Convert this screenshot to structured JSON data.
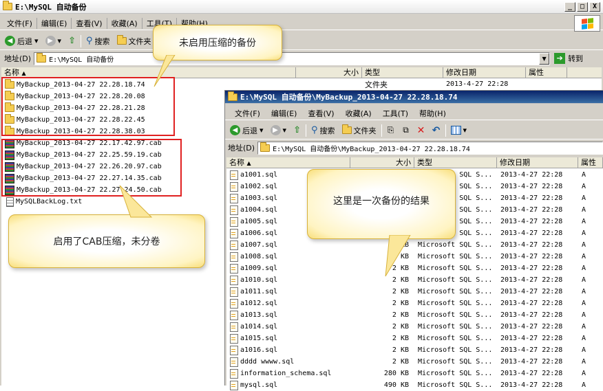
{
  "window1": {
    "title": "E:\\MySQL 自动备份",
    "caption_buttons": [
      "_",
      "□",
      "X"
    ],
    "menu": [
      "文件(F)",
      "编辑(E)",
      "查看(V)",
      "收藏(A)",
      "工具(T)",
      "帮助(H)"
    ],
    "toolbar": {
      "back": "后退",
      "search": "搜索",
      "folders": "文件夹"
    },
    "address_label": "地址(D)",
    "address_value": "E:\\MySQL 自动备份",
    "goto_label": "转到",
    "columns": [
      "名称",
      "大小",
      "类型",
      "修改日期",
      "属性"
    ],
    "first_row": {
      "type": "文件夹",
      "date": "2013-4-27 22:28"
    },
    "folders": [
      "MyBackup_2013-04-27 22.28.18.74",
      "MyBackup_2013-04-27 22.28.20.08",
      "MyBackup_2013-04-27 22.28.21.28",
      "MyBackup_2013-04-27 22.28.22.45",
      "MyBackup_2013-04-27 22.28.38.03"
    ],
    "cab_files": [
      "MyBackup_2013-04-27 22.17.42.97.cab",
      "MyBackup_2013-04-27 22.25.59.19.cab",
      "MyBackup_2013-04-27 22.26.20.97.cab",
      "MyBackup_2013-04-27 22.27.14.35.cab",
      "MyBackup_2013-04-27 22.27.24.50.cab"
    ],
    "log_file": "MySQLBackLog.txt"
  },
  "window2": {
    "title": "E:\\MySQL 自动备份\\MyBackup_2013-04-27 22.28.18.74",
    "menu": [
      "文件(F)",
      "编辑(E)",
      "查看(V)",
      "收藏(A)",
      "工具(T)",
      "帮助(H)"
    ],
    "toolbar": {
      "back": "后退",
      "search": "搜索",
      "folders": "文件夹"
    },
    "address_label": "地址(D)",
    "address_value": "E:\\MySQL 自动备份\\MyBackup_2013-04-27 22.28.18.74",
    "columns": [
      "名称",
      "大小",
      "类型",
      "修改日期",
      "属性"
    ],
    "files": [
      {
        "name": "a1001.sql",
        "size": "",
        "type": "Microsoft SQL S...",
        "date": "2013-4-27 22:28",
        "attr": "A"
      },
      {
        "name": "a1002.sql",
        "size": "",
        "type": "Microsoft SQL S...",
        "date": "2013-4-27 22:28",
        "attr": "A"
      },
      {
        "name": "a1003.sql",
        "size": "",
        "type": "Microsoft SQL S...",
        "date": "2013-4-27 22:28",
        "attr": "A"
      },
      {
        "name": "a1004.sql",
        "size": "",
        "type": "Microsoft SQL S...",
        "date": "2013-4-27 22:28",
        "attr": "A"
      },
      {
        "name": "a1005.sql",
        "size": "",
        "type": "Microsoft SQL S...",
        "date": "2013-4-27 22:28",
        "attr": "A"
      },
      {
        "name": "a1006.sql",
        "size": "",
        "type": "Microsoft SQL S...",
        "date": "2013-4-27 22:28",
        "attr": "A"
      },
      {
        "name": "a1007.sql",
        "size": "2 KB",
        "type": "Microsoft SQL S...",
        "date": "2013-4-27 22:28",
        "attr": "A"
      },
      {
        "name": "a1008.sql",
        "size": "2 KB",
        "type": "Microsoft SQL S...",
        "date": "2013-4-27 22:28",
        "attr": "A"
      },
      {
        "name": "a1009.sql",
        "size": "2 KB",
        "type": "Microsoft SQL S...",
        "date": "2013-4-27 22:28",
        "attr": "A"
      },
      {
        "name": "a1010.sql",
        "size": "2 KB",
        "type": "Microsoft SQL S...",
        "date": "2013-4-27 22:28",
        "attr": "A"
      },
      {
        "name": "a1011.sql",
        "size": "2 KB",
        "type": "Microsoft SQL S...",
        "date": "2013-4-27 22:28",
        "attr": "A"
      },
      {
        "name": "a1012.sql",
        "size": "2 KB",
        "type": "Microsoft SQL S...",
        "date": "2013-4-27 22:28",
        "attr": "A"
      },
      {
        "name": "a1013.sql",
        "size": "2 KB",
        "type": "Microsoft SQL S...",
        "date": "2013-4-27 22:28",
        "attr": "A"
      },
      {
        "name": "a1014.sql",
        "size": "2 KB",
        "type": "Microsoft SQL S...",
        "date": "2013-4-27 22:28",
        "attr": "A"
      },
      {
        "name": "a1015.sql",
        "size": "2 KB",
        "type": "Microsoft SQL S...",
        "date": "2013-4-27 22:28",
        "attr": "A"
      },
      {
        "name": "a1016.sql",
        "size": "2 KB",
        "type": "Microsoft SQL S...",
        "date": "2013-4-27 22:28",
        "attr": "A"
      },
      {
        "name": "dddd wwww.sql",
        "size": "2 KB",
        "type": "Microsoft SQL S...",
        "date": "2013-4-27 22:28",
        "attr": "A"
      },
      {
        "name": "information_schema.sql",
        "size": "280 KB",
        "type": "Microsoft SQL S...",
        "date": "2013-4-27 22:28",
        "attr": "A"
      },
      {
        "name": "mysql.sql",
        "size": "490 KB",
        "type": "Microsoft SQL S...",
        "date": "2013-4-27 22:28",
        "attr": "A"
      }
    ]
  },
  "callouts": {
    "uncompressed": "未启用压缩的备份",
    "cab": "启用了CAB压缩，未分卷",
    "result": "这里是一次备份的结果"
  },
  "colors": {
    "highlight_box": "#e02020",
    "callout_fill": "#fff4c2",
    "title_active": "#0a246a"
  }
}
